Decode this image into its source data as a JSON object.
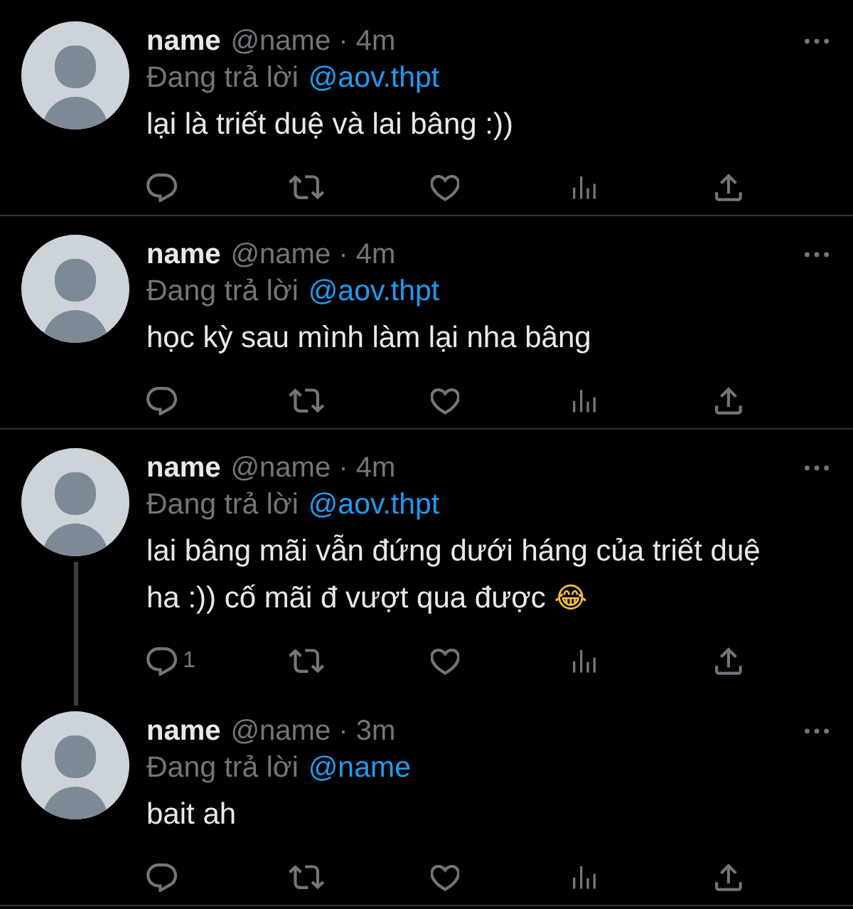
{
  "tweets": [
    {
      "name": "name",
      "meta": "@name · 4m",
      "reply_label": "Đang trả lời",
      "reply_to": "@aov.thpt",
      "text": "lại là triết duệ và lai bâng :))",
      "thread_continues": false
    },
    {
      "name": "name",
      "meta": "@name · 4m",
      "reply_label": "Đang trả lời",
      "reply_to": "@aov.thpt",
      "text": "học kỳ sau mình làm lại nha bâng",
      "thread_continues": false
    },
    {
      "name": "name",
      "meta": "@name · 4m",
      "reply_label": "Đang trả lời",
      "reply_to": "@aov.thpt",
      "text": "lai bâng mãi vẫn đứng dưới háng của triết duệ ha :)) cố mãi đ vượt qua được 😂",
      "reply_count": "1",
      "thread_continues": true
    },
    {
      "name": "name",
      "meta": "@name · 3m",
      "reply_label": "Đang trả lời",
      "reply_to": "@name",
      "text": "bait ah",
      "thread_continues": false
    }
  ]
}
